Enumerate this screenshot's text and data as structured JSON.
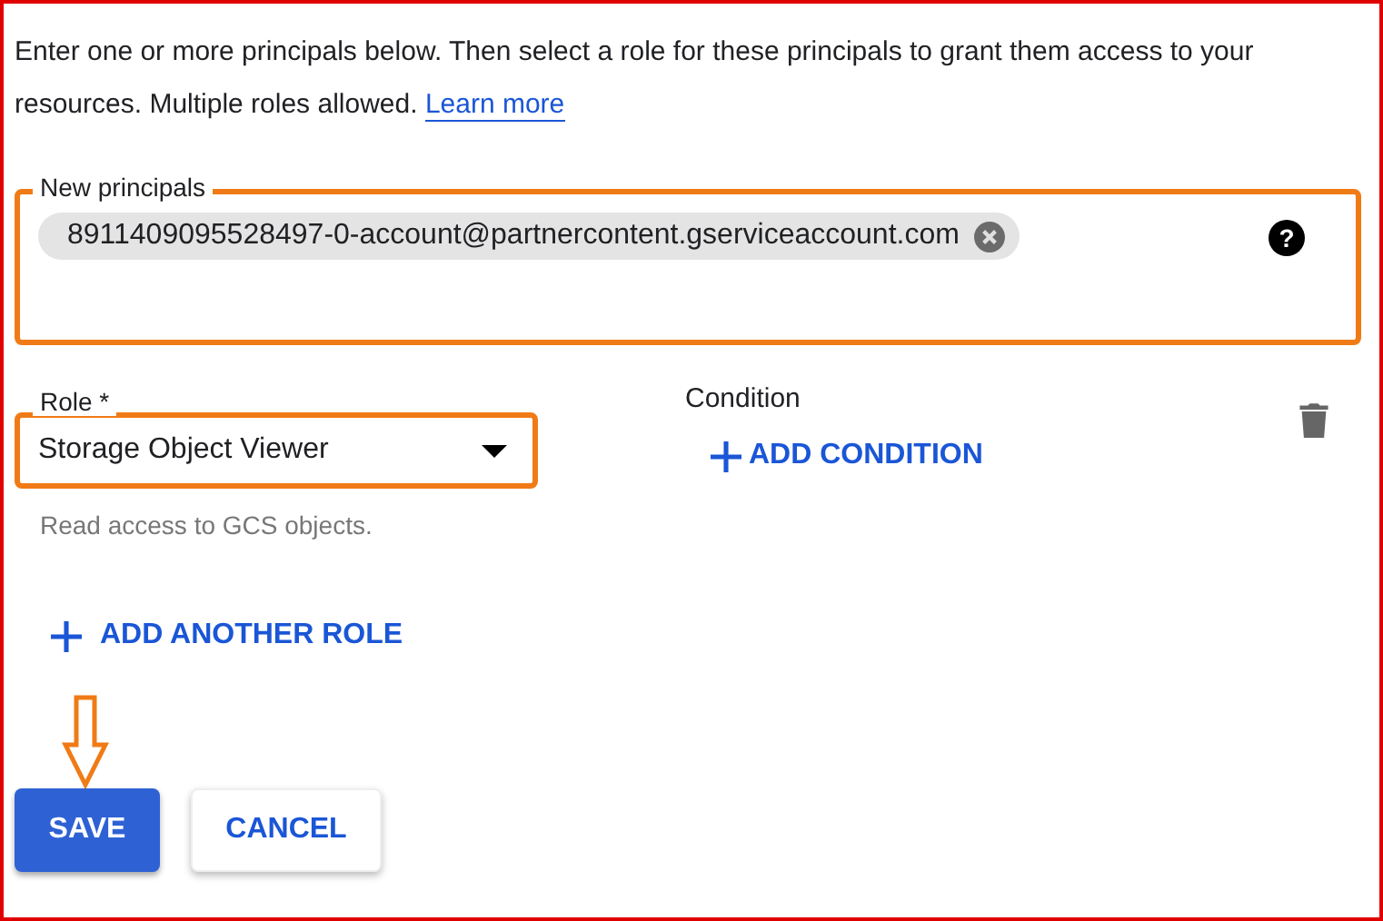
{
  "intro": {
    "text": "Enter one or more principals below. Then select a role for these principals to grant them access to your resources. Multiple roles allowed.",
    "link": "Learn more"
  },
  "principals": {
    "label": "New principals",
    "highlighted": true,
    "help": "?",
    "chips": [
      {
        "text": "8911409095528497-0-account@partnercontent.gserviceaccount.com"
      }
    ]
  },
  "role": {
    "label": "Role *",
    "value": "Storage Object Viewer",
    "helper": "Read access to GCS objects.",
    "highlighted": true
  },
  "condition": {
    "label": "Condition",
    "action": "ADD CONDITION"
  },
  "add_role": "ADD ANOTHER ROLE",
  "buttons": [
    {
      "label": "SAVE",
      "kind": "primary",
      "pointed": true
    },
    {
      "label": "CANCEL",
      "kind": "secondary",
      "pointed": false
    }
  ]
}
